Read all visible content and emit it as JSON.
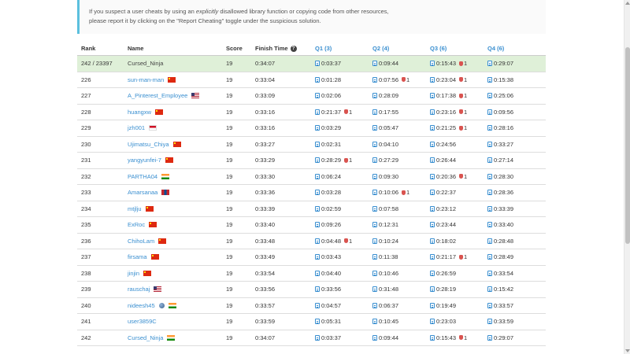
{
  "notice": {
    "line1_pre": "If you suspect a user cheats by using an ",
    "line1_em": "explicitly",
    "line1_post": " disallowed library function or copying code from other resources,",
    "line2": "please report it by clicking on the \"Report Cheating\" toggle under the suspicious solution."
  },
  "table": {
    "headers": {
      "rank": "Rank",
      "name": "Name",
      "score": "Score",
      "finish_time": "Finish Time",
      "q1": "Q1 (3)",
      "q2": "Q2 (4)",
      "q3": "Q3 (6)",
      "q4": "Q4 (6)"
    },
    "rows": [
      {
        "rank": "242 / 23397",
        "name": "Cursed_Ninja",
        "flag": "",
        "score": "19",
        "time": "0:34:07",
        "q1": "0:03:37",
        "q1b": "",
        "q2": "0:09:44",
        "q2b": "",
        "q3": "0:15:43",
        "q3b": "1",
        "q4": "0:29:07",
        "q4b": "",
        "highlight": true
      },
      {
        "rank": "226",
        "name": "sun-man-man",
        "flag": "cn",
        "score": "19",
        "time": "0:33:04",
        "q1": "0:01:28",
        "q1b": "",
        "q2": "0:07:56",
        "q2b": "1",
        "q3": "0:23:04",
        "q3b": "1",
        "q4": "0:15:38",
        "q4b": ""
      },
      {
        "rank": "227",
        "name": "A_Pinterest_Employee",
        "flag": "us",
        "score": "19",
        "time": "0:33:09",
        "q1": "0:02:06",
        "q1b": "",
        "q2": "0:28:09",
        "q2b": "",
        "q3": "0:17:38",
        "q3b": "1",
        "q4": "0:25:06",
        "q4b": ""
      },
      {
        "rank": "228",
        "name": "huangxw",
        "flag": "cn",
        "score": "19",
        "time": "0:33:16",
        "q1": "0:21:37",
        "q1b": "1",
        "q2": "0:17:55",
        "q2b": "",
        "q3": "0:23:16",
        "q3b": "1",
        "q4": "0:09:56",
        "q4b": ""
      },
      {
        "rank": "229",
        "name": "jzh001",
        "flag": "id",
        "score": "19",
        "time": "0:33:16",
        "q1": "0:03:29",
        "q1b": "",
        "q2": "0:05:47",
        "q2b": "",
        "q3": "0:21:25",
        "q3b": "1",
        "q4": "0:28:16",
        "q4b": ""
      },
      {
        "rank": "230",
        "name": "Ujimatsu_Chiya",
        "flag": "cn",
        "score": "19",
        "time": "0:33:27",
        "q1": "0:02:31",
        "q1b": "",
        "q2": "0:04:10",
        "q2b": "",
        "q3": "0:24:56",
        "q3b": "",
        "q4": "0:33:27",
        "q4b": ""
      },
      {
        "rank": "231",
        "name": "yangyunfei-7",
        "flag": "cn",
        "score": "19",
        "time": "0:33:29",
        "q1": "0:28:29",
        "q1b": "1",
        "q2": "0:27:29",
        "q2b": "",
        "q3": "0:26:44",
        "q3b": "",
        "q4": "0:27:14",
        "q4b": ""
      },
      {
        "rank": "232",
        "name": "PARTHA04",
        "flag": "in",
        "score": "19",
        "time": "0:33:30",
        "q1": "0:06:24",
        "q1b": "",
        "q2": "0:09:30",
        "q2b": "",
        "q3": "0:20:36",
        "q3b": "1",
        "q4": "0:28:30",
        "q4b": ""
      },
      {
        "rank": "233",
        "name": "Amarsanaa",
        "flag": "mn",
        "score": "19",
        "time": "0:33:36",
        "q1": "0:03:28",
        "q1b": "",
        "q2": "0:10:06",
        "q2b": "1",
        "q3": "0:22:37",
        "q3b": "",
        "q4": "0:28:36",
        "q4b": ""
      },
      {
        "rank": "234",
        "name": "mtjlju",
        "flag": "cn",
        "score": "19",
        "time": "0:33:39",
        "q1": "0:02:59",
        "q1b": "",
        "q2": "0:07:58",
        "q2b": "",
        "q3": "0:23:12",
        "q3b": "",
        "q4": "0:33:39",
        "q4b": ""
      },
      {
        "rank": "235",
        "name": "ExRoc",
        "flag": "cn",
        "score": "19",
        "time": "0:33:40",
        "q1": "0:09:26",
        "q1b": "",
        "q2": "0:12:31",
        "q2b": "",
        "q3": "0:23:44",
        "q3b": "",
        "q4": "0:33:40",
        "q4b": ""
      },
      {
        "rank": "236",
        "name": "ChihoLam",
        "flag": "cn",
        "score": "19",
        "time": "0:33:48",
        "q1": "0:04:48",
        "q1b": "1",
        "q2": "0:10:24",
        "q2b": "",
        "q3": "0:18:02",
        "q3b": "",
        "q4": "0:28:48",
        "q4b": ""
      },
      {
        "rank": "237",
        "name": "firsama",
        "flag": "cn",
        "score": "19",
        "time": "0:33:49",
        "q1": "0:03:43",
        "q1b": "",
        "q2": "0:11:38",
        "q2b": "",
        "q3": "0:21:17",
        "q3b": "1",
        "q4": "0:28:49",
        "q4b": ""
      },
      {
        "rank": "238",
        "name": "jinjin",
        "flag": "cn",
        "score": "19",
        "time": "0:33:54",
        "q1": "0:04:40",
        "q1b": "",
        "q2": "0:10:46",
        "q2b": "",
        "q3": "0:26:59",
        "q3b": "",
        "q4": "0:33:54",
        "q4b": ""
      },
      {
        "rank": "239",
        "name": "rauschaj",
        "flag": "us",
        "score": "19",
        "time": "0:33:56",
        "q1": "0:33:56",
        "q1b": "",
        "q2": "0:31:48",
        "q2b": "",
        "q3": "0:28:19",
        "q3b": "",
        "q4": "0:15:42",
        "q4b": ""
      },
      {
        "rank": "240",
        "name": "nideesh45",
        "flag": "in",
        "globe": true,
        "score": "19",
        "time": "0:33:57",
        "q1": "0:04:57",
        "q1b": "",
        "q2": "0:06:37",
        "q2b": "",
        "q3": "0:19:49",
        "q3b": "",
        "q4": "0:33:57",
        "q4b": ""
      },
      {
        "rank": "241",
        "name": "user3859C",
        "flag": "",
        "score": "19",
        "time": "0:33:59",
        "q1": "0:05:31",
        "q1b": "",
        "q2": "0:10:45",
        "q2b": "",
        "q3": "0:23:03",
        "q3b": "",
        "q4": "0:33:59",
        "q4b": ""
      },
      {
        "rank": "242",
        "name": "Cursed_Ninja",
        "flag": "in",
        "score": "19",
        "time": "0:34:07",
        "q1": "0:03:37",
        "q1b": "",
        "q2": "0:09:44",
        "q2b": "",
        "q3": "0:15:43",
        "q3b": "1",
        "q4": "0:29:07",
        "q4b": ""
      }
    ]
  }
}
